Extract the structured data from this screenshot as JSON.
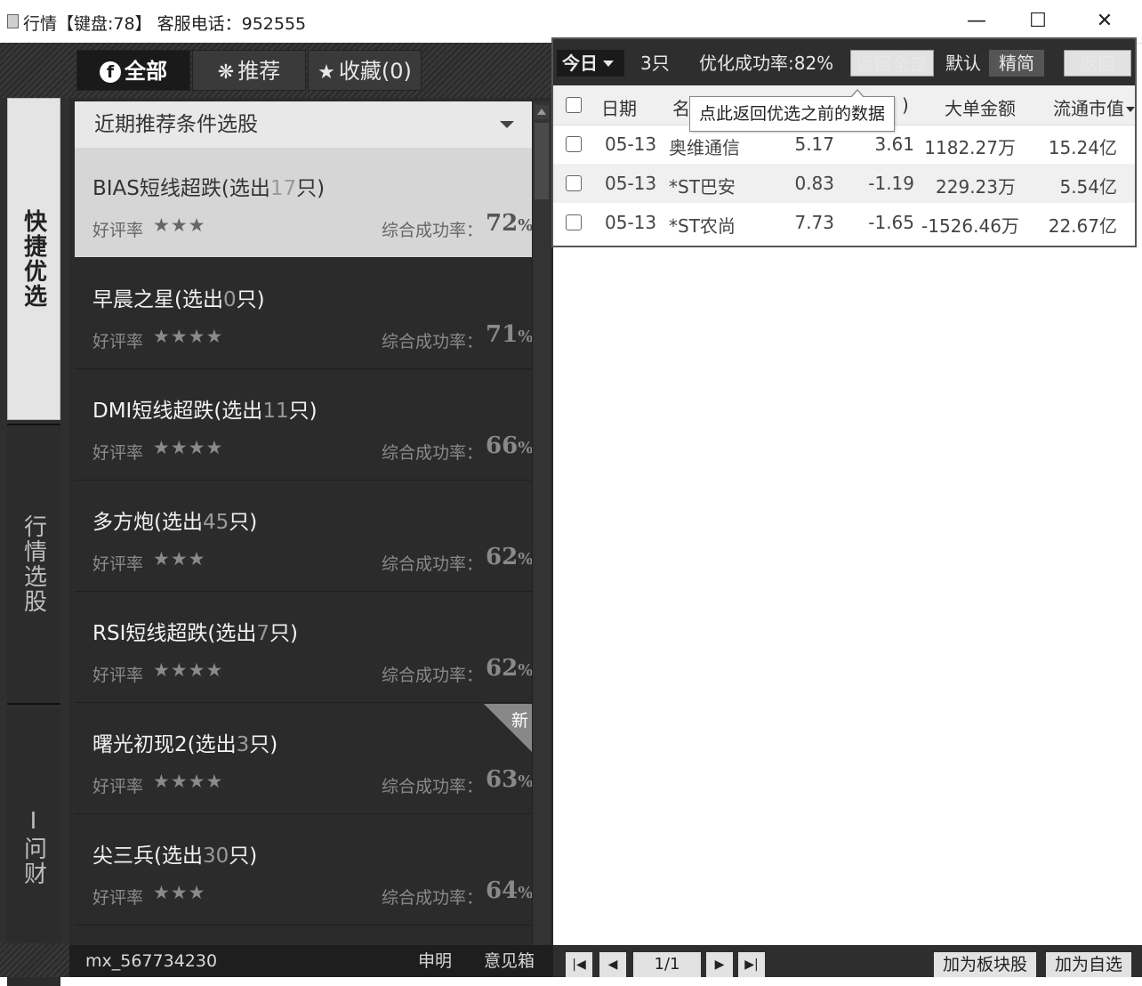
{
  "window": {
    "title": "行情【键盘:78】 客服电话：952555",
    "minimize": "—",
    "maximize": "☐",
    "close": "✕"
  },
  "side_nav": [
    {
      "label": "快捷优选",
      "active": true
    },
    {
      "label": "行情选股",
      "active": false
    },
    {
      "label": "I问财",
      "active": false
    }
  ],
  "panel_tabs": [
    {
      "icon": "f",
      "label": "全部",
      "active": true
    },
    {
      "icon": "❋",
      "label": "推荐",
      "active": false
    },
    {
      "icon": "★",
      "label": "收藏(0)",
      "active": false
    }
  ],
  "dropdown": {
    "label": "近期推荐条件选股"
  },
  "strategies": [
    {
      "name": "BIAS短线超跌(选出",
      "count": "17",
      "suffix": "只)",
      "rating_label": "好评率",
      "stars": "★★★",
      "rate_label": "综合成功率：",
      "rate": "72",
      "pct": "%",
      "selected": true,
      "is_new": false
    },
    {
      "name": "早晨之星(选出",
      "count": "0",
      "suffix": "只)",
      "rating_label": "好评率",
      "stars": "★★★★",
      "rate_label": "综合成功率：",
      "rate": "71",
      "pct": "%",
      "selected": false,
      "is_new": false
    },
    {
      "name": "DMI短线超跌(选出",
      "count": "11",
      "suffix": "只)",
      "rating_label": "好评率",
      "stars": "★★★★",
      "rate_label": "综合成功率：",
      "rate": "66",
      "pct": "%",
      "selected": false,
      "is_new": false
    },
    {
      "name": "多方炮(选出",
      "count": "45",
      "suffix": "只)",
      "rating_label": "好评率",
      "stars": "★★★",
      "rate_label": "综合成功率：",
      "rate": "62",
      "pct": "%",
      "selected": false,
      "is_new": false
    },
    {
      "name": "RSI短线超跌(选出",
      "count": "7",
      "suffix": "只)",
      "rating_label": "好评率",
      "stars": "★★★★",
      "rate_label": "综合成功率：",
      "rate": "62",
      "pct": "%",
      "selected": false,
      "is_new": false
    },
    {
      "name": "曙光初现2(选出",
      "count": "3",
      "suffix": "只)",
      "rating_label": "好评率",
      "stars": "★★★★",
      "rate_label": "综合成功率：",
      "rate": "63",
      "pct": "%",
      "selected": false,
      "is_new": true,
      "new_label": "新"
    },
    {
      "name": "尖三兵(选出",
      "count": "30",
      "suffix": "只)",
      "rating_label": "好评率",
      "stars": "★★★",
      "rate_label": "综合成功率：",
      "rate": "64",
      "pct": "%",
      "selected": false,
      "is_new": false
    }
  ],
  "left_footer": {
    "user": "mx_567734230",
    "disclaimer": "申明",
    "feedback": "意见箱"
  },
  "results": {
    "toolbar": {
      "today": "今日",
      "count": "3只",
      "opt_rate": "优化成功率:82%",
      "return_all": "返回全部",
      "default": "默认",
      "compact": "精简",
      "back": "返回"
    },
    "tooltip": "点此返回优选之前的数据",
    "headers": {
      "date": "日期",
      "name_part": "名",
      "change_part": ")",
      "big_order": "大单金额",
      "float_cap": "流通市值"
    },
    "rows": [
      {
        "date": "05-13",
        "name": "奥维通信",
        "price": "5.17",
        "change": "3.61",
        "big_order": "1182.27万",
        "float_cap": "15.24亿"
      },
      {
        "date": "05-13",
        "name": "*ST巴安",
        "price": "0.83",
        "change": "-1.19",
        "big_order": "229.23万",
        "float_cap": "5.54亿"
      },
      {
        "date": "05-13",
        "name": "*ST农尚",
        "price": "7.73",
        "change": "-1.65",
        "big_order": "-1526.46万",
        "float_cap": "22.67亿"
      }
    ]
  },
  "pager": {
    "first": "|◀",
    "prev": "◀",
    "info": "1/1",
    "next": "▶",
    "last": "▶|"
  },
  "actions": {
    "add_block": "加为板块股",
    "add_fav": "加为自选"
  },
  "colors": {
    "dark_bg": "#2b2b2b",
    "selected_item": "#d6d6d6",
    "toolbar_bg": "#2e2e2e"
  }
}
